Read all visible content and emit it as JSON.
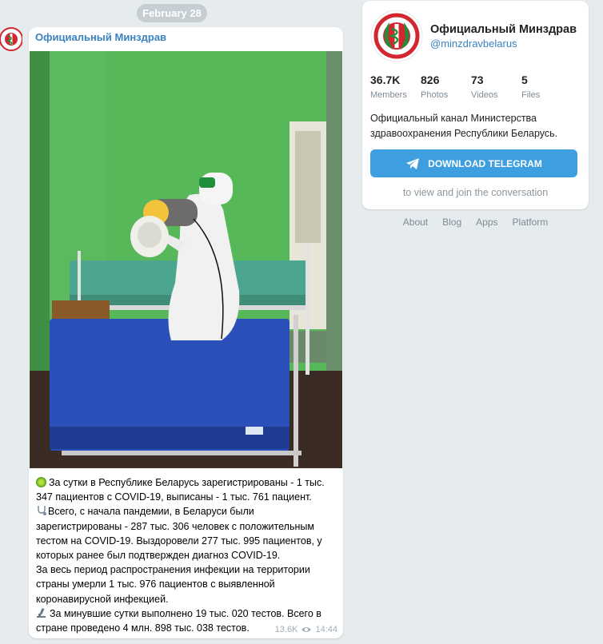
{
  "date_separator": "February 28",
  "message": {
    "author": "Официальный Минздрав",
    "lines": [
      "За сутки в Республике Беларусь зарегистрированы - 1 тыс.",
      "347 пациентов с COVID-19, выписаны - 1 тыс. 761 пациент.",
      "Всего, с начала пандемии, в Беларуси были",
      "зарегистрированы - 287 тыс. 306 человек с положительным",
      "тестом на COVID-19. Выздоровели 277 тыс. 995 пациентов, у",
      "которых ранее был подтвержден диагноз COVID-19.",
      "За весь период распространения инфекции на территории",
      "страны умерли 1 тыс. 976 пациентов с выявленной",
      "коронавирусной инфекцией.",
      "За минувшие сутки выполнено 19 тыс. 020 тестов. Всего в",
      "стране проведено 4 млн. 898 тыс. 038 тестов."
    ],
    "views": "13.6K",
    "time": "14:44"
  },
  "channel": {
    "name": "Официальный Минздрав",
    "handle": "@minzdravbelarus",
    "stats": [
      {
        "value": "36.7K",
        "label": "Members"
      },
      {
        "value": "826",
        "label": "Photos"
      },
      {
        "value": "73",
        "label": "Videos"
      },
      {
        "value": "5",
        "label": "Files"
      }
    ],
    "description": "Официальный канал Министерства здравоохранения Республики Беларусь.",
    "button_label": "DOWNLOAD TELEGRAM",
    "note": "to view and join the conversation"
  },
  "footer_links": [
    "About",
    "Blog",
    "Apps",
    "Platform"
  ],
  "colors": {
    "accent": "#3a82c0",
    "button": "#3d9fe0",
    "wall": "#57b85a",
    "logo_red": "#d3262e",
    "logo_green": "#1f8f3c"
  }
}
